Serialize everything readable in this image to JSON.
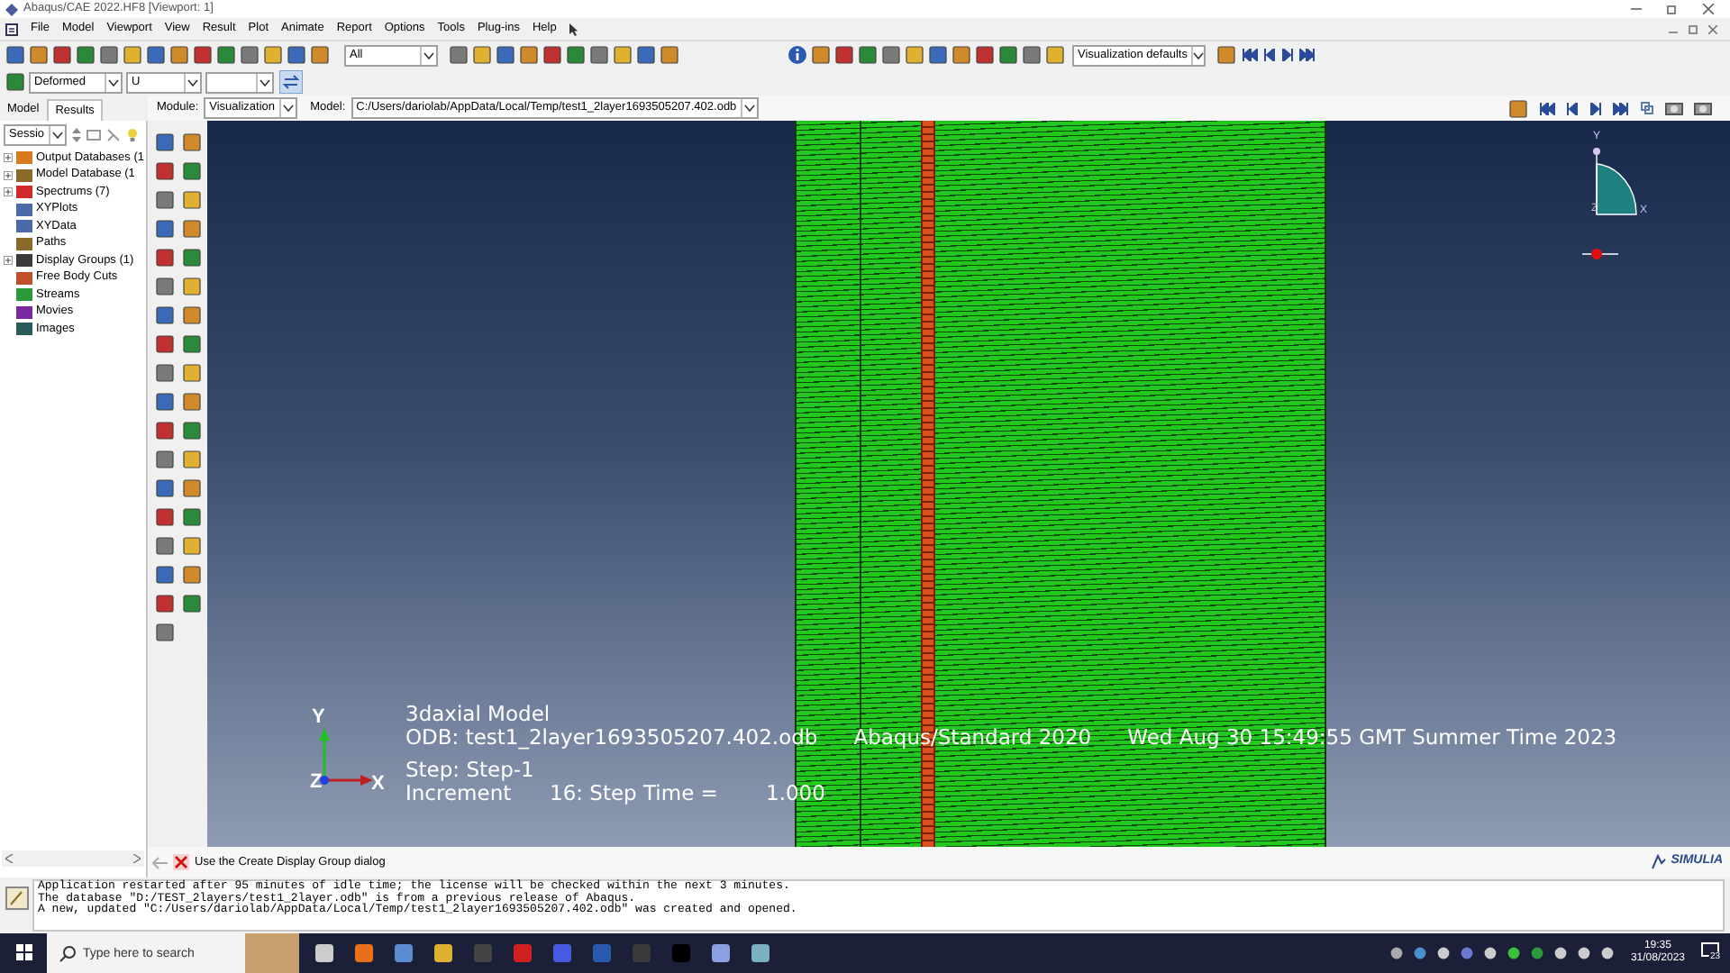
{
  "window": {
    "title": "Abaqus/CAE 2022.HF8 [Viewport: 1]"
  },
  "menu": [
    "File",
    "Model",
    "Viewport",
    "View",
    "Result",
    "Plot",
    "Animate",
    "Report",
    "Options",
    "Tools",
    "Plug-ins",
    "Help"
  ],
  "toolbar": {
    "selection_filter": "All",
    "view_style": "Visualization defaults"
  },
  "plot_toolbar": {
    "plot_state": "Deformed",
    "field_output": "U"
  },
  "context": {
    "tabs": [
      {
        "label": "Model",
        "selected": false
      },
      {
        "label": "Results",
        "selected": true
      }
    ],
    "module_label": "Module:",
    "module": "Visualization",
    "model_label": "Model:",
    "model_path": "C:/Users/dariolab/AppData/Local/Temp/test1_2layer1693505207.402.odb"
  },
  "tree": {
    "selector": "Sessio",
    "items": [
      {
        "label": "Output Databases (1",
        "collapsed": true,
        "color": "#d97a1c"
      },
      {
        "label": "Model Database (1",
        "collapsed": true,
        "color": "#8a6a2a"
      },
      {
        "label": "Spectrums (7)",
        "collapsed": true,
        "color": "#d02a2a"
      },
      {
        "label": "XYPlots",
        "collapsed": false,
        "color": "#4a6aa8"
      },
      {
        "label": "XYData",
        "collapsed": false,
        "color": "#4a6aa8"
      },
      {
        "label": "Paths",
        "collapsed": false,
        "color": "#8a6a2a"
      },
      {
        "label": "Display Groups (1)",
        "collapsed": true,
        "color": "#3a3a3a"
      },
      {
        "label": "Free Body Cuts",
        "collapsed": false,
        "color": "#c0502a"
      },
      {
        "label": "Streams",
        "collapsed": false,
        "color": "#2a9a3a"
      },
      {
        "label": "Movies",
        "collapsed": false,
        "color": "#7a2aa0"
      },
      {
        "label": "Images",
        "collapsed": false,
        "color": "#2a5a5a"
      }
    ]
  },
  "viewport": {
    "title": "3daxial Model",
    "odb": "ODB: test1_2layer1693505207.402.odb",
    "solver": "Abaqus/Standard 2020",
    "date": "Wed Aug 30 15:49:55 GMT Summer Time 2023",
    "step": "Step: Step-1",
    "increment": "Increment",
    "increment_value": "16: Step Time =",
    "step_time": "1.000",
    "triad": {
      "y": "Y",
      "z": "Z",
      "x": "X"
    },
    "mini_triad": {
      "y": "Y",
      "z": "Z",
      "x": "X"
    }
  },
  "prompt": "Use the Create Display Group dialog",
  "brand": "SIMULIA",
  "messages": [
    "Application restarted after 95 minutes of idle time; the license will be checked within the next 3 minutes.",
    "The database \"D:/TEST_2layers/test1_2layer.odb\" is from a previous release of Abaqus.",
    "A new, updated \"C:/Users/dariolab/AppData/Local/Temp/test1_2layer1693505207.402.odb\" was created and opened."
  ],
  "taskbar": {
    "search_placeholder": "Type here to search",
    "time": "19:35",
    "date": "31/08/2023",
    "notifications": "23"
  }
}
